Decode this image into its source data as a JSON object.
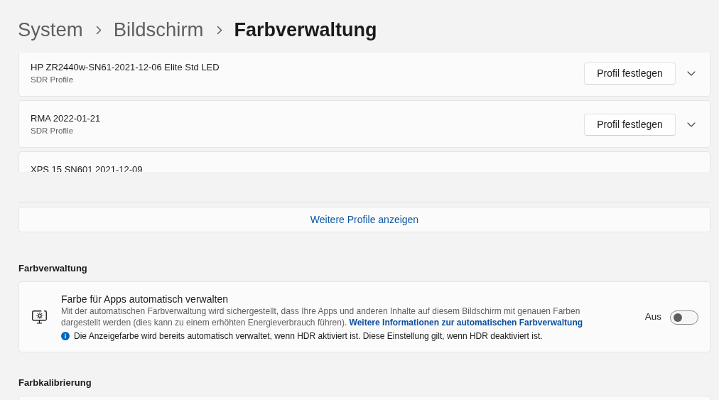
{
  "breadcrumb": [
    {
      "label": "System",
      "current": false
    },
    {
      "label": "Bildschirm",
      "current": false
    },
    {
      "label": "Farbverwaltung",
      "current": true
    }
  ],
  "profiles": [
    {
      "name": "HP ZR2440w-SN61-2021-12-06 Elite Std LED",
      "type": "SDR Profile",
      "action": "Profil festlegen",
      "expanded": false
    },
    {
      "name": "RMA 2022-01-21",
      "type": "SDR Profile",
      "action": "Profil festlegen",
      "expanded": false
    },
    {
      "name": "XPS 15 SN601 2021-12-09"
    }
  ],
  "more_profiles_button": "Weitere Profile anzeigen",
  "sections": [
    {
      "heading": "Farbverwaltung",
      "settings": [
        {
          "title": "Farbe für Apps automatisch verwalten",
          "description": "Mit der automatischen Farbverwaltung wird sichergestellt, dass Ihre Apps und anderen Inhalte auf diesem Bildschirm mit genauen Farben dargestellt werden (dies kann zu einem erhöhten Energieverbrauch führen).",
          "link": "Weitere Informationen zur automatischen Farbverwaltung",
          "info": "Die Anzeigefarbe wird bereits automatisch verwaltet, wenn HDR aktiviert ist. Diese Einstellung gilt, wenn HDR deaktiviert ist.",
          "state_label": "Aus",
          "on": false
        }
      ]
    },
    {
      "heading": "Farbkalibrierung"
    }
  ]
}
